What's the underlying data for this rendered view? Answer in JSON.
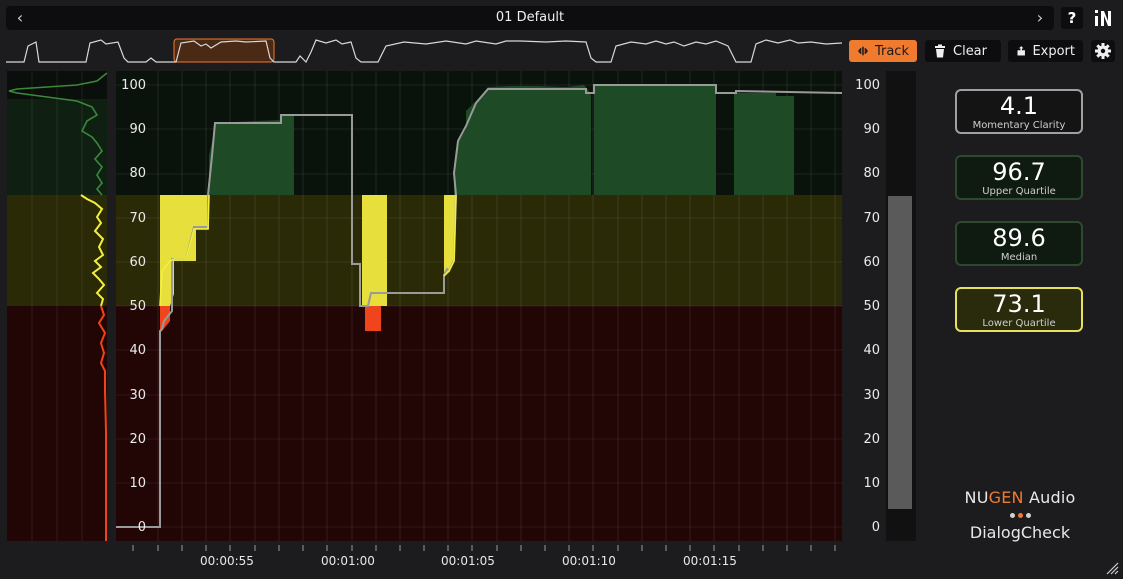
{
  "header": {
    "preset_title": "01 Default",
    "prev_icon": "chevron-left-icon",
    "next_icon": "chevron-right-icon",
    "help_label": "?",
    "logo_label": "N"
  },
  "toolbar": {
    "track_label": "Track",
    "clear_label": "Clear",
    "export_label": "Export",
    "settings_icon": "gear-icon"
  },
  "axis": {
    "left_ticks": [
      "100",
      "90",
      "80",
      "70",
      "60",
      "50",
      "40",
      "30",
      "20",
      "10",
      "0"
    ],
    "right_ticks": [
      "100",
      "90",
      "80",
      "70",
      "60",
      "50",
      "40",
      "30",
      "20",
      "10",
      "0"
    ],
    "time_labels": [
      "00:00:55",
      "00:01:00",
      "00:01:05",
      "00:01:10",
      "00:01:15"
    ]
  },
  "readouts": [
    {
      "value": "4.1",
      "label": "Momentary Clarity"
    },
    {
      "value": "96.7",
      "label": "Upper Quartile"
    },
    {
      "value": "89.6",
      "label": "Median"
    },
    {
      "value": "73.1",
      "label": "Lower Quartile"
    }
  ],
  "brand": {
    "nu": "NU",
    "gen": "GEN",
    "audio": " Audio",
    "product": "DialogCheck"
  },
  "colors": {
    "accent": "#f07a2e",
    "green_zone": "#0a1a0c",
    "yellow_zone": "#2a2a07",
    "red_zone": "#1f0606",
    "good": "#1e4a26",
    "fair": "#e6df3c",
    "poor": "#f0441c"
  },
  "meter": {
    "momentary_clarity": 4.1,
    "scale_min": 0,
    "scale_max": 100
  }
}
